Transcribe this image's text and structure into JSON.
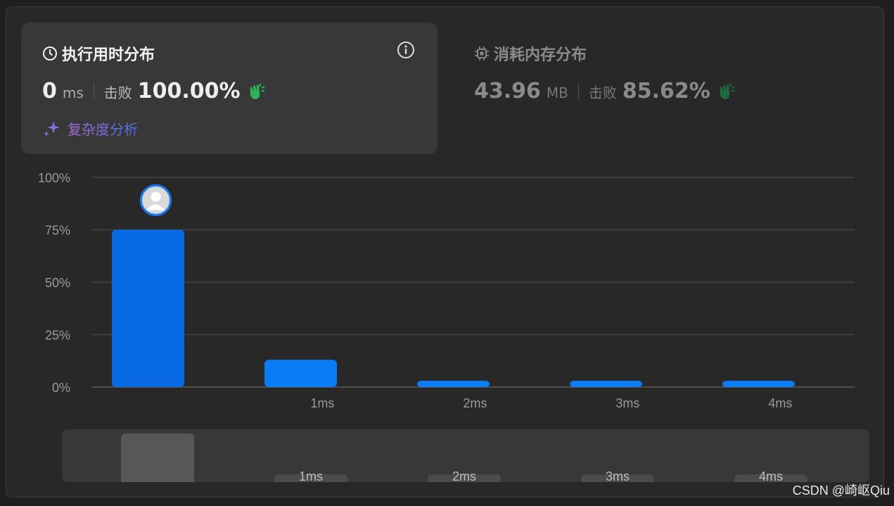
{
  "runtime": {
    "title": "执行用时分布",
    "value": "0",
    "unit": "ms",
    "beat_label": "击败",
    "beat_value": "100.00%",
    "analysis_label": "复杂度分析"
  },
  "memory": {
    "title": "消耗内存分布",
    "value": "43.96",
    "unit": "MB",
    "beat_label": "击败",
    "beat_value": "85.62%"
  },
  "icons": {
    "clock": "clock-icon",
    "info": "info-icon",
    "chip": "chip-icon",
    "clap": "clap-icon",
    "sparkle": "sparkle-icon",
    "avatar": "avatar-icon"
  },
  "colors": {
    "bar": "#0a7cf5",
    "bar_selected": "#086ae3",
    "clap_active": "#2db55d",
    "clap_inactive": "#1f6b3b"
  },
  "chart_data": {
    "type": "bar",
    "categories": [
      "0ms",
      "1ms",
      "2ms",
      "3ms",
      "4ms"
    ],
    "x_tick_labels": [
      "",
      "1ms",
      "2ms",
      "3ms",
      "4ms"
    ],
    "values": [
      75,
      13,
      3,
      3,
      3
    ],
    "y_ticks": [
      "100%",
      "75%",
      "50%",
      "25%",
      "0%"
    ],
    "ylim": [
      0,
      100
    ],
    "grid": true,
    "selected_index": 0
  },
  "mini_chart": {
    "labels": [
      "",
      "1ms",
      "2ms",
      "3ms",
      "4ms"
    ]
  },
  "watermark": "CSDN @崎岖Qiu"
}
